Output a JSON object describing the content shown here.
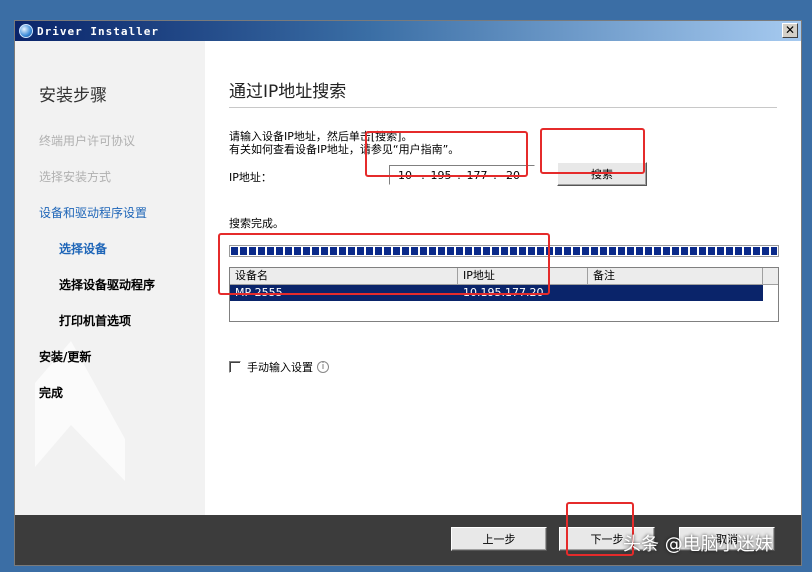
{
  "window": {
    "title": "Driver Installer",
    "close_glyph": "✕"
  },
  "sidebar": {
    "heading": "安装步骤",
    "steps": [
      {
        "label": "终端用户许可协议",
        "state": "done"
      },
      {
        "label": "选择安装方式",
        "state": "done"
      },
      {
        "label": "设备和驱动程序设置",
        "state": "active"
      },
      {
        "label": "选择设备",
        "state": "sub-active"
      },
      {
        "label": "选择设备驱动程序",
        "state": "sub"
      },
      {
        "label": "打印机首选项",
        "state": "sub"
      },
      {
        "label": "安装/更新",
        "state": "pending"
      },
      {
        "label": "完成",
        "state": "pending"
      }
    ]
  },
  "main": {
    "title": "通过IP地址搜索",
    "instruction_line1": "请输入设备IP地址，然后单击[搜索]。",
    "instruction_line2": "有关如何查看设备IP地址，请参见“用户指南”。",
    "ip_label": "IP地址：",
    "ip_segments": [
      "10",
      "195",
      "177",
      "20"
    ],
    "search_button": "搜索",
    "status": "搜索完成。",
    "progress": 1.0,
    "table": {
      "columns": [
        "设备名",
        "IP地址",
        "备注"
      ],
      "rows": [
        {
          "device": "MP 2555",
          "ip": "10.195.177.20",
          "note": ""
        }
      ]
    },
    "manual_checkbox_label": "手动输入设置",
    "manual_checked": false
  },
  "footer": {
    "back_button": "上一步",
    "next_button": "下一步",
    "cancel_button": "取消"
  },
  "watermark": "头条 @电脑小迷妹",
  "colors": {
    "selection": "#0a246a",
    "accent_blue": "#1f66b8",
    "highlight_red": "#e52b2b",
    "desktop": "#3b6ea5"
  }
}
